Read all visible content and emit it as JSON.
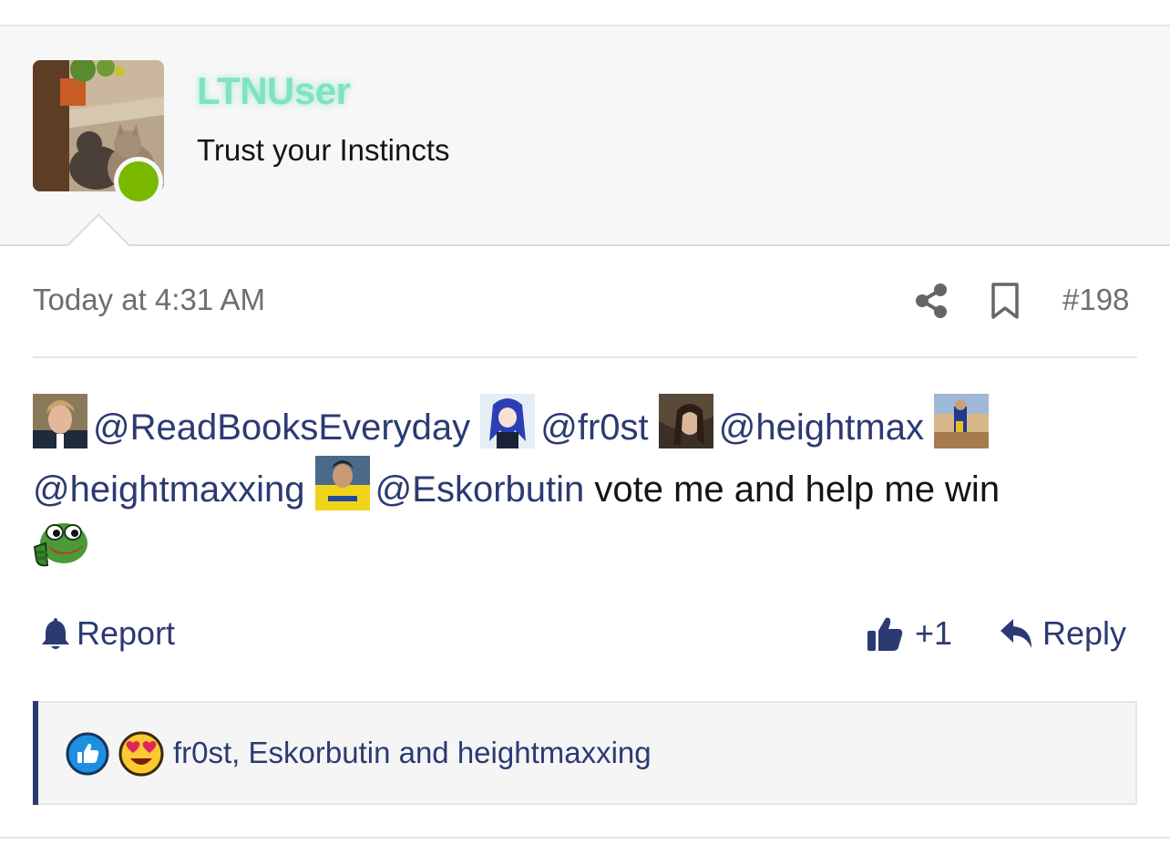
{
  "user": {
    "username": "LTNUser",
    "title": "Trust your Instincts",
    "avatar_icon": "cats-photo-avatar",
    "online": true,
    "username_color": "#7fe3c2",
    "online_color": "#7ab800"
  },
  "post": {
    "timestamp": "Today at 4:31 AM",
    "number": "#198",
    "share_icon": "share-icon",
    "bookmark_icon": "bookmark-icon",
    "mentions": [
      {
        "handle": "@ReadBooksEveryday"
      },
      {
        "handle": "@fr0st"
      },
      {
        "handle": "@heightmax"
      },
      {
        "handle": "@heightmaxxing"
      },
      {
        "handle": "@Eskorbutin"
      }
    ],
    "message_text": " vote me and help me win",
    "emoji": "pepe-thumbs-up"
  },
  "actions": {
    "report_label": "Report",
    "like_label": "+1",
    "reply_label": "Reply"
  },
  "reactions": {
    "icons": [
      "like-reaction-icon",
      "love-reaction-icon"
    ],
    "summary": "fr0st, Eskorbutin and heightmaxxing"
  },
  "colors": {
    "link": "#2c3a73",
    "meta": "#6e6e6e",
    "header_bg": "#f7f7f7"
  }
}
